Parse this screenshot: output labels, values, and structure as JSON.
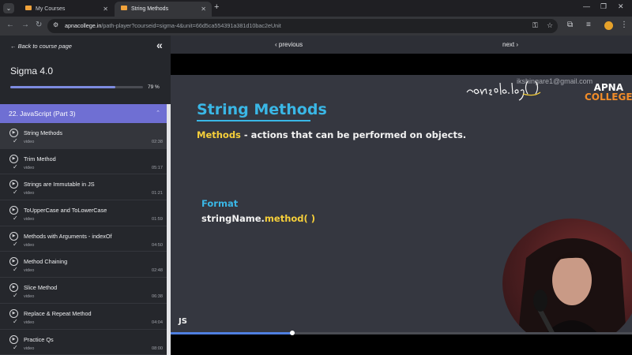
{
  "browser": {
    "tabs": [
      {
        "title": "My Courses",
        "active": false
      },
      {
        "title": "String Methods",
        "active": true
      }
    ],
    "address": {
      "host": "apnacollege.in",
      "path": "/path-player?courseid=sigma-4&unit=66d5ca554391a381d10bac2eUnit"
    }
  },
  "sidebar": {
    "back_label": "Back to course page",
    "course_title": "Sigma 4.0",
    "progress_percent": 79,
    "progress_label": "79 %",
    "section_title": "22. JavaScript (Part 3)",
    "lessons": [
      {
        "title": "String Methods",
        "type": "video",
        "duration": "02:38",
        "current": true
      },
      {
        "title": "Trim Method",
        "type": "video",
        "duration": "05:17",
        "current": false
      },
      {
        "title": "Strings are Immutable in JS",
        "type": "video",
        "duration": "01:21",
        "current": false
      },
      {
        "title": "ToUpperCase and ToLowerCase",
        "type": "video",
        "duration": "01:59",
        "current": false
      },
      {
        "title": "Methods with Arguments - indexOf",
        "type": "video",
        "duration": "04:50",
        "current": false
      },
      {
        "title": "Method Chaining",
        "type": "video",
        "duration": "02:48",
        "current": false
      },
      {
        "title": "Slice Method",
        "type": "video",
        "duration": "06:38",
        "current": false
      },
      {
        "title": "Replace & Repeat Method",
        "type": "video",
        "duration": "04:04",
        "current": false
      },
      {
        "title": "Practice Qs",
        "type": "video",
        "duration": "08:00",
        "current": false
      }
    ]
  },
  "player": {
    "prev_label": "‹ previous",
    "next_label": "next ›",
    "seek_fraction": 0.263
  },
  "slide": {
    "title": "String Methods",
    "subtitle_highlight": "Methods",
    "subtitle_rest": " - actions that can be performed on objects.",
    "format_label": "Format",
    "format_code_prefix": "stringName.",
    "format_code_method": "method( )",
    "tag": "JS",
    "logo_line1": "APNA",
    "logo_line2": "COLLEGE",
    "watermark": "ikshingare1@gmail.com",
    "handwriting": "console.log( )"
  },
  "colors": {
    "accent": "#6f6fd3",
    "slide_title": "#3ab7e6",
    "highlight": "#f6cf3a"
  }
}
